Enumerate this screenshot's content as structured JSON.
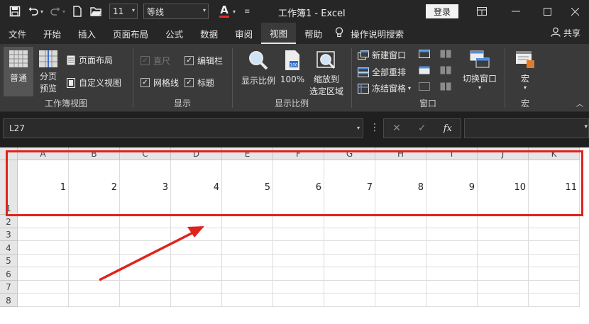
{
  "titlebar": {
    "font_size": "11",
    "font_name": "等线",
    "font_color_letter": "A",
    "title": "工作簿1  -  Excel",
    "login": "登录"
  },
  "menu": {
    "tabs": [
      "文件",
      "开始",
      "插入",
      "页面布局",
      "公式",
      "数据",
      "审阅",
      "视图",
      "帮助",
      "操作说明搜索"
    ],
    "active": "视图",
    "share": "共享"
  },
  "ribbon": {
    "workbook_views": {
      "normal": "普通",
      "page_break_1": "分页",
      "page_break_2": "预览",
      "page_layout": "页面布局",
      "custom_views": "自定义视图",
      "label": "工作簿视图"
    },
    "show": {
      "ruler": "直尺",
      "formula_bar": "编辑栏",
      "gridlines": "网格线",
      "headings": "标题",
      "label": "显示"
    },
    "zoom": {
      "zoom": "显示比例",
      "hundred": "100%",
      "zoom_selection_1": "缩放到",
      "zoom_selection_2": "选定区域",
      "label": "显示比例"
    },
    "window": {
      "new_window": "新建窗口",
      "arrange_all": "全部重排",
      "freeze_panes": "冻结窗格",
      "switch_windows": "切换窗口",
      "label": "窗口"
    },
    "macros": {
      "macros": "宏",
      "label": "宏"
    }
  },
  "formula_bar": {
    "name_box": "L27",
    "fx": "fx"
  },
  "sheet": {
    "columns": [
      "A",
      "B",
      "C",
      "D",
      "E",
      "F",
      "G",
      "H",
      "I",
      "J",
      "K"
    ],
    "rows": [
      "1",
      "2",
      "3",
      "4",
      "5",
      "6",
      "7",
      "8"
    ],
    "row1_values": [
      "1",
      "2",
      "3",
      "4",
      "5",
      "6",
      "7",
      "8",
      "9",
      "10",
      "11"
    ]
  },
  "colors": {
    "annotation": "#e0231c",
    "dark_bg": "#1f1f1f",
    "ribbon_bg": "#3a3a3a"
  }
}
